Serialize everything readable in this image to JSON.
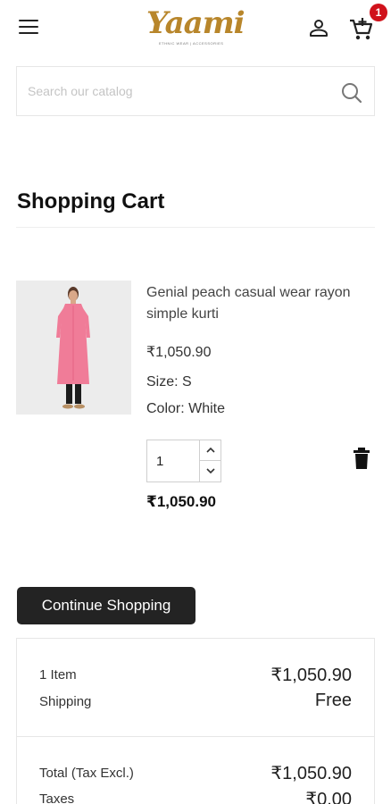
{
  "header": {
    "logo_text": "Yaami",
    "logo_tagline": "ETHNIC WEAR | ACCESSORIES",
    "cart_count": "1"
  },
  "search": {
    "placeholder": "Search our catalog"
  },
  "page_title": "Shopping Cart",
  "cart_item": {
    "name": "Genial peach casual wear rayon simple kurti",
    "price": "₹1,050.90",
    "size": "Size: S",
    "color": "Color: White",
    "quantity": "1",
    "line_total": "₹1,050.90"
  },
  "continue_label": "Continue Shopping",
  "summary": {
    "items_label": "1 Item",
    "items_value": "₹1,050.90",
    "shipping_label": "Shipping",
    "shipping_value": "Free",
    "total_label": "Total (Tax Excl.)",
    "total_value": "₹1,050.90",
    "taxes_label": "Taxes",
    "taxes_value": "₹0.00"
  },
  "colors": {
    "badge": "#d0121b",
    "button_dark": "#232323",
    "logo_gold": "#b8862b"
  }
}
